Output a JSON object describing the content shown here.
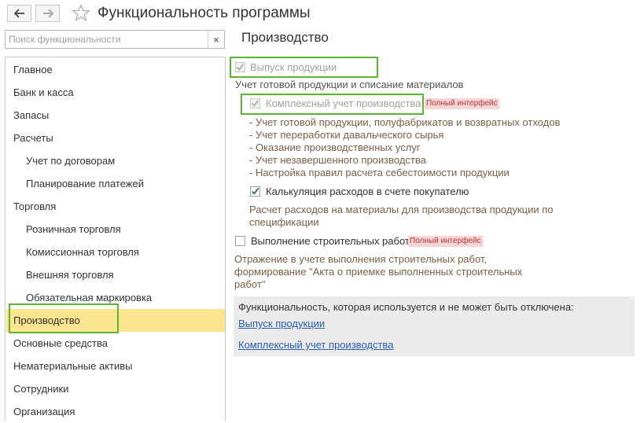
{
  "window": {
    "title": "Функциональность программы",
    "back_icon": "arrow-left-icon",
    "forward_icon": "arrow-right-icon",
    "favorite_icon": "star-icon"
  },
  "search": {
    "placeholder": "Поиск функциональности",
    "clear_label": "×"
  },
  "sidebar": {
    "items": [
      {
        "label": "Главное"
      },
      {
        "label": "Банк и касса"
      },
      {
        "label": "Запасы"
      },
      {
        "label": "Расчеты"
      },
      {
        "label": "Учет по договорам"
      },
      {
        "label": "Планирование платежей"
      },
      {
        "label": "Торговля"
      },
      {
        "label": "Розничная торговля"
      },
      {
        "label": "Комиссионная торговля"
      },
      {
        "label": "Внешняя торговля"
      },
      {
        "label": "Обязательная маркировка"
      },
      {
        "label": "Производство"
      },
      {
        "label": "Основные средства"
      },
      {
        "label": "Нематериальные активы"
      },
      {
        "label": "Сотрудники"
      },
      {
        "label": "Организация"
      }
    ],
    "selected": "Производство"
  },
  "main": {
    "section_title": "Производство",
    "production_output": {
      "label": "Выпуск продукции",
      "checked": true,
      "enabled": false,
      "description": "Учет готовой продукции и списание материалов"
    },
    "complex_accounting": {
      "label": "Комплексный учет производства",
      "checked": true,
      "enabled": false,
      "badge": "Полный интерфейс",
      "details": [
        "- Учет готовой продукции, полуфабрикатов и возвратных отходов",
        "- Учет переработки давальческого сырья",
        "- Оказание производственных услуг",
        "- Учет незавершенного производства",
        "- Настройка правил расчета себестоимости продукции"
      ]
    },
    "cost_calculation": {
      "label": "Калькуляция расходов в счете покупателю",
      "checked": true,
      "description_line1": "Расчет расходов на материалы для производства продукции по",
      "description_line2": "спецификации"
    },
    "construction": {
      "label": "Выполнение строительных работ",
      "checked": false,
      "badge": "Полный интерфейс",
      "description_line1": "Отражение в учете выполнения строительных работ,",
      "description_line2": "формирование \"Акта о приемке выполненных строительных",
      "description_line3": "работ\""
    },
    "info_box": {
      "text": "Функциональность, которая используется и не может быть отключена:",
      "links": [
        "Выпуск продукции",
        "Комплексный учет производства"
      ]
    }
  },
  "colors": {
    "selected_bg": "#fbe58e",
    "highlight_border": "#5cb531",
    "badge_bg": "#f8d4d4",
    "badge_text": "#b03a3a",
    "link": "#2a5db0",
    "description": "#7a6045",
    "check": "#2e7d32"
  }
}
